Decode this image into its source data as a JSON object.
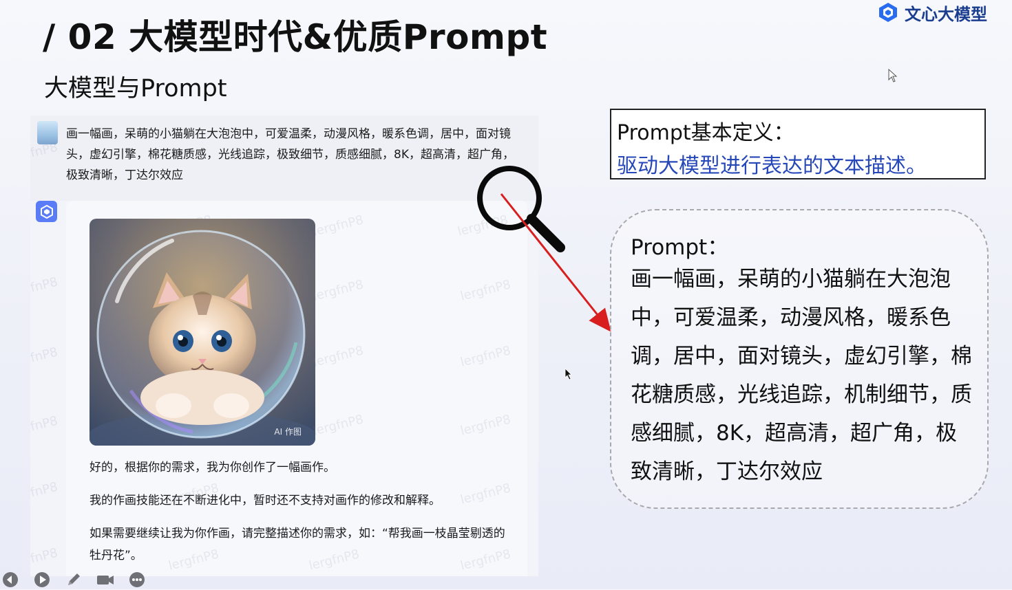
{
  "slide": {
    "title": "/ 02  大模型时代&优质Prompt",
    "subtitle": "大模型与Prompt"
  },
  "brand": {
    "name": "文心大模型",
    "color": "#1a3d8f"
  },
  "chat": {
    "user_message": "画一幅画，呆萌的小猫躺在大泡泡中，可爱温柔，动漫风格，暖系色调，居中，面对镜头，虚幻引擎，棉花糖质感，光线追踪，极致细节，质感细腻，8K，超高清，超广角，极致清晰，丁达尔效应",
    "image_tag": "AI 作图",
    "bot_reply_1": "好的，根据你的需求，我为你创作了一幅画作。",
    "bot_reply_2": "我的作画技能还在不断进化中，暂时还不支持对画作的修改和解释。",
    "bot_reply_3": "如果需要继续让我为你作画，请完整描述你的需求，如：“帮我画一枝晶莹剔透的牡丹花”。",
    "watermark": "lergfnP8",
    "watermark_edge": "fnP8"
  },
  "definition": {
    "title": "Prompt基本定义：",
    "text": "驱动大模型进行表达的文本描述。"
  },
  "prompt_box": {
    "label": "Prompt：",
    "text": "画一幅画，呆萌的小猫躺在大泡泡中，可爱温柔，动漫风格，暖系色调，居中，面对镜头，虚幻引擎，棉花糖质感，光线追踪，机制细节，质感细腻，8K，超高清，超广角，极致清晰，丁达尔效应"
  },
  "colors": {
    "accent_blue": "#2647b8",
    "arrow_red": "#d81e1e"
  },
  "controls": [
    "previous-icon",
    "play-icon",
    "pen-icon",
    "camera-icon",
    "more-icon"
  ]
}
